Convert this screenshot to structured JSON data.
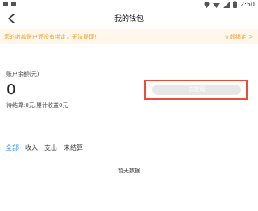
{
  "status_bar": {
    "time": "2:50"
  },
  "header": {
    "title": "我的钱包"
  },
  "notice": {
    "text": "您的收款账户还没有绑定，无法提现！",
    "action": "立即绑定 >"
  },
  "balance": {
    "label": "账户余额(元)",
    "value": "0",
    "pending_line": "待结算:0元,累计收益0元"
  },
  "withdraw": {
    "label": "去提现"
  },
  "tabs": [
    {
      "label": "全部",
      "active": true
    },
    {
      "label": "收入",
      "active": false
    },
    {
      "label": "支出",
      "active": false
    },
    {
      "label": "未结算",
      "active": false
    }
  ],
  "empty_state": {
    "text": "暂无数据"
  },
  "colors": {
    "accent": "#2f8cff",
    "notice_text": "#f39a2b",
    "notice_bg": "#fff7ea",
    "highlight_border": "#e74c3c"
  }
}
